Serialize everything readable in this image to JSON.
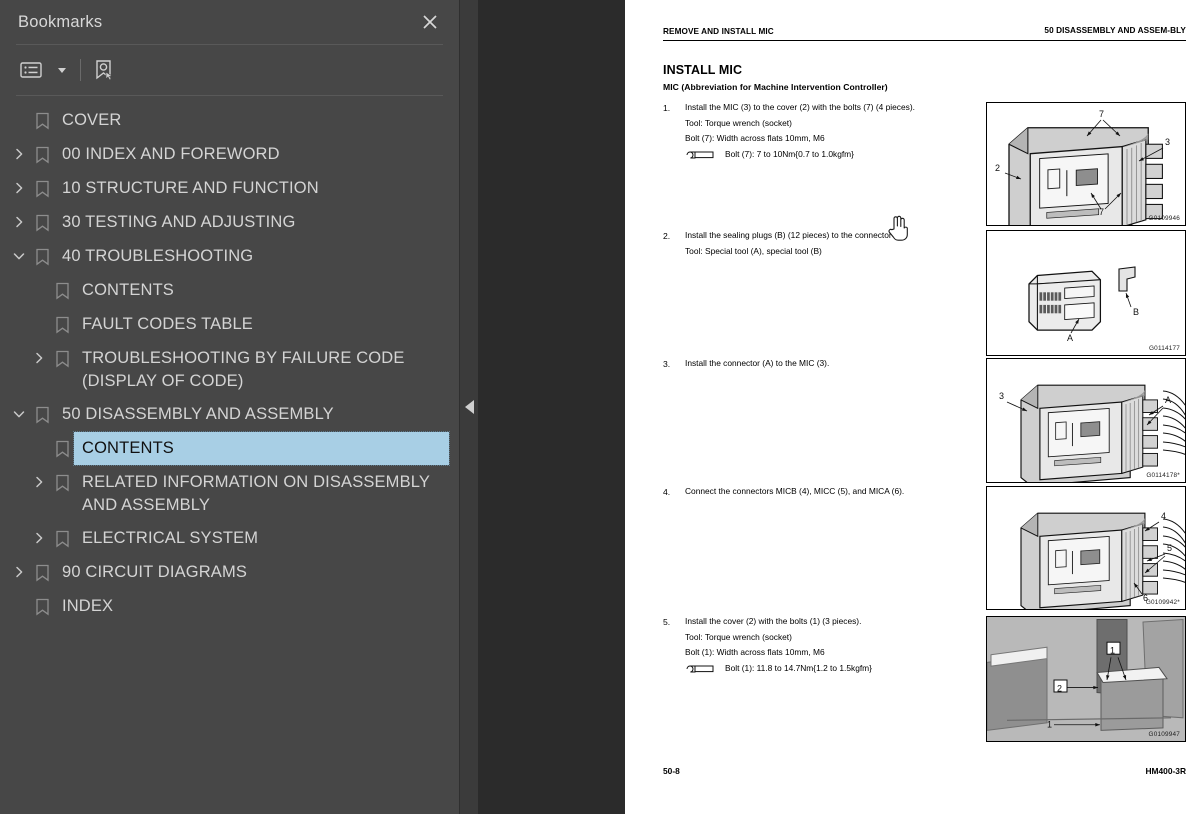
{
  "bookmarks_panel": {
    "title": "Bookmarks",
    "close_icon": "close-icon",
    "toolbar": {
      "list_options_icon": "list-options-icon",
      "dropdown_caret_icon": "chevron-down-icon",
      "find_bookmark_icon": "bookmark-pointer-icon"
    },
    "selection_color": "#a8cfe5",
    "background_color": "#474747",
    "items": [
      {
        "label": "COVER",
        "level": 1,
        "twisty": "none",
        "selected": false
      },
      {
        "label": "00 INDEX AND FOREWORD",
        "level": 1,
        "twisty": "collapsed",
        "selected": false
      },
      {
        "label": "10 STRUCTURE AND FUNCTION",
        "level": 1,
        "twisty": "collapsed",
        "selected": false
      },
      {
        "label": "30 TESTING AND ADJUSTING",
        "level": 1,
        "twisty": "collapsed",
        "selected": false
      },
      {
        "label": "40 TROUBLESHOOTING",
        "level": 1,
        "twisty": "expanded",
        "selected": false
      },
      {
        "label": "CONTENTS",
        "level": 2,
        "twisty": "none",
        "selected": false
      },
      {
        "label": "FAULT CODES TABLE",
        "level": 2,
        "twisty": "none",
        "selected": false
      },
      {
        "label": "TROUBLESHOOTING BY FAILURE CODE (DISPLAY OF CODE)",
        "level": 2,
        "twisty": "collapsed",
        "selected": false
      },
      {
        "label": "50 DISASSEMBLY AND ASSEMBLY",
        "level": 1,
        "twisty": "expanded",
        "selected": false
      },
      {
        "label": "CONTENTS",
        "level": 2,
        "twisty": "none",
        "selected": true
      },
      {
        "label": "RELATED INFORMATION ON DISASSEMBLY AND ASSEMBLY",
        "level": 2,
        "twisty": "collapsed",
        "selected": false
      },
      {
        "label": "ELECTRICAL SYSTEM",
        "level": 2,
        "twisty": "collapsed",
        "selected": false
      },
      {
        "label": "90 CIRCUIT DIAGRAMS",
        "level": 1,
        "twisty": "collapsed",
        "selected": false
      },
      {
        "label": "INDEX",
        "level": 1,
        "twisty": "none",
        "selected": false
      }
    ]
  },
  "collapse_handle": {
    "icon": "triangle-left-icon"
  },
  "document": {
    "header": {
      "left": "REMOVE AND INSTALL MIC",
      "right": "50 DISASSEMBLY AND ASSEM-BLY"
    },
    "section_title": "INSTALL MIC",
    "section_subtitle": "MIC (Abbreviation for Machine Intervention Controller)",
    "steps": [
      {
        "num": "1.",
        "lines": [
          "Install the MIC (3) to the cover (2) with the bolts (7) (4 pieces).",
          "Tool: Torque wrench (socket)",
          "Bolt (7): Width across flats 10mm, M6"
        ],
        "torque": "Bolt (7): 7 to 10Nm{0.7 to 1.0kgfm}",
        "figure": {
          "id": "G0109946",
          "callouts": [
            "7",
            "3",
            "2",
            "7"
          ]
        }
      },
      {
        "num": "2.",
        "lines": [
          "Install the sealing plugs (B) (12 pieces) to the connector (A).",
          "Tool: Special tool (A), special tool (B)"
        ],
        "torque": null,
        "figure": {
          "id": "G0114177",
          "callouts": [
            "B",
            "A"
          ]
        }
      },
      {
        "num": "3.",
        "lines": [
          "Install the connector (A) to the MIC (3)."
        ],
        "torque": null,
        "figure": {
          "id": "G0114178*",
          "callouts": [
            "3",
            "A"
          ]
        }
      },
      {
        "num": "4.",
        "lines": [
          "Connect the connectors MICB (4), MICC (5), and MICA (6)."
        ],
        "torque": null,
        "figure": {
          "id": "G0109942*",
          "callouts": [
            "4",
            "5",
            "6"
          ]
        }
      },
      {
        "num": "5.",
        "lines": [
          "Install the cover (2) with the bolts (1) (3 pieces).",
          "Tool: Torque wrench (socket)",
          "Bolt (1): Width across flats 10mm, M6"
        ],
        "torque": "Bolt (1): 11.8 to 14.7Nm{1.2 to 1.5kgfm}",
        "figure": {
          "id": "G0109947",
          "callouts": [
            "1",
            "2",
            "1"
          ]
        }
      }
    ],
    "footer": {
      "left": "50-8",
      "right": "HM400-3R"
    }
  },
  "cursor": {
    "icon": "hand-pointer-cursor"
  }
}
